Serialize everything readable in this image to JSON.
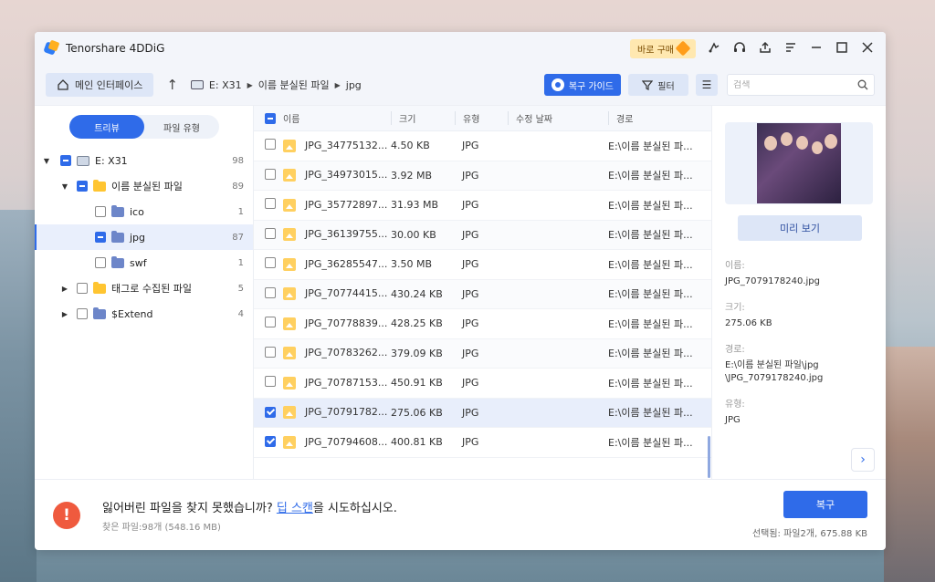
{
  "app": {
    "title": "Tenorshare 4DDiG",
    "buy_label": "바로 구매"
  },
  "toolbar": {
    "home_label": "메인 인터페이스",
    "breadcrumb": [
      "E: X31",
      "이름 분실된 파일",
      "jpg"
    ],
    "guide_label": "복구 가이드",
    "filter_label": "필터",
    "search_placeholder": "검색"
  },
  "view_tabs": {
    "tree": "트리뷰",
    "type": "파일 유형"
  },
  "tree": [
    {
      "label": "E: X31",
      "count": "98"
    },
    {
      "label": "이름 분실된 파일",
      "count": "89"
    },
    {
      "label": "ico",
      "count": "1"
    },
    {
      "label": "jpg",
      "count": "87"
    },
    {
      "label": "swf",
      "count": "1"
    },
    {
      "label": "태그로 수집된 파일",
      "count": "5"
    },
    {
      "label": "$Extend",
      "count": "4"
    }
  ],
  "table": {
    "headers": {
      "name": "이름",
      "size": "크기",
      "type": "유형",
      "date": "수정 날짜",
      "path": "경로"
    },
    "rows": [
      {
        "name": "JPG_34775132...",
        "size": "4.50 KB",
        "type": "JPG",
        "path": "E:\\이름 분실된 파..."
      },
      {
        "name": "JPG_34973015...",
        "size": "3.92 MB",
        "type": "JPG",
        "path": "E:\\이름 분실된 파..."
      },
      {
        "name": "JPG_35772897...",
        "size": "31.93 MB",
        "type": "JPG",
        "path": "E:\\이름 분실된 파..."
      },
      {
        "name": "JPG_36139755...",
        "size": "30.00 KB",
        "type": "JPG",
        "path": "E:\\이름 분실된 파..."
      },
      {
        "name": "JPG_36285547...",
        "size": "3.50 MB",
        "type": "JPG",
        "path": "E:\\이름 분실된 파..."
      },
      {
        "name": "JPG_70774415...",
        "size": "430.24 KB",
        "type": "JPG",
        "path": "E:\\이름 분실된 파..."
      },
      {
        "name": "JPG_70778839...",
        "size": "428.25 KB",
        "type": "JPG",
        "path": "E:\\이름 분실된 파..."
      },
      {
        "name": "JPG_70783262...",
        "size": "379.09 KB",
        "type": "JPG",
        "path": "E:\\이름 분실된 파..."
      },
      {
        "name": "JPG_70787153...",
        "size": "450.91 KB",
        "type": "JPG",
        "path": "E:\\이름 분실된 파..."
      },
      {
        "name": "JPG_70791782...",
        "size": "275.06 KB",
        "type": "JPG",
        "path": "E:\\이름 분실된 파..."
      },
      {
        "name": "JPG_70794608...",
        "size": "400.81 KB",
        "type": "JPG",
        "path": "E:\\이름 분실된 파..."
      }
    ]
  },
  "preview": {
    "button_label": "미리 보기",
    "name_label": "이름:",
    "name_value": "JPG_7079178240.jpg",
    "size_label": "크기:",
    "size_value": "275.06 KB",
    "path_label": "경로:",
    "path_value_line1": "E:\\이름 분실된 파일\\jpg",
    "path_value_line2": "\\JPG_7079178240.jpg",
    "type_label": "유형:",
    "type_value": "JPG"
  },
  "footer": {
    "message_before": "잃어버린 파일을 찾지 못했습니까? ",
    "message_link": "딥 스캔",
    "message_after": "을 시도하십시오.",
    "found": "찾은 파일:98개 (548.16 MB)",
    "recover_label": "복구",
    "selected": "선택됨: 파일2개, 675.88 KB"
  },
  "colors": {
    "accent": "#2f6be9",
    "alert": "#ef5a3e"
  },
  "icons": [
    "logo-icon",
    "diamond-icon",
    "feedback-icon",
    "headset-icon",
    "share-icon",
    "menu-icon",
    "minimize-icon",
    "maximize-icon",
    "close-icon",
    "home-icon",
    "up-arrow-icon",
    "drive-icon",
    "eye-icon",
    "filter-icon",
    "list-view-icon",
    "search-icon",
    "folder-icon",
    "image-file-icon",
    "chevron-right-icon",
    "alert-icon"
  ]
}
